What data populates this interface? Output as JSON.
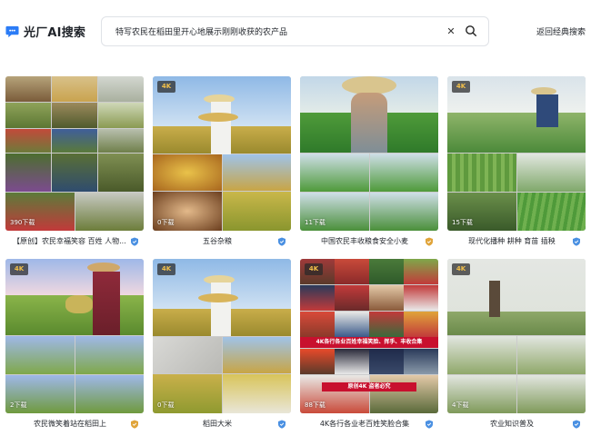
{
  "header": {
    "logo_text": "光厂AI搜索",
    "search_value": "特写农民在稻田里开心地展示刚刚收获的农产品",
    "back_label": "返回经典搜索"
  },
  "colors": {
    "accent": "#2b7cf6",
    "badge_text": "#f2c04a",
    "verify_blue": "#4a90e2",
    "verify_gold": "#e0a43a"
  },
  "cards": [
    {
      "caption": "【原创】农民幸福笑容 百姓 人物...",
      "badge": "",
      "downloads": "390下载",
      "verify": "blue"
    },
    {
      "caption": "五谷杂粮",
      "badge": "4K",
      "downloads": "0下载",
      "verify": "blue"
    },
    {
      "caption": "中国农民丰收粮食安全小麦",
      "badge": "",
      "downloads": "11下载",
      "verify": "gold"
    },
    {
      "caption": "现代化播种 耕种 育苗 插秧",
      "badge": "4K",
      "downloads": "15下载",
      "verify": "blue"
    },
    {
      "caption": "农民微笑着站在稻田上",
      "badge": "4K",
      "downloads": "2下载",
      "verify": "gold"
    },
    {
      "caption": "稻田大米",
      "badge": "4K",
      "downloads": "0下载",
      "verify": "blue"
    },
    {
      "caption": "4K各行各业老百姓笑脸合集",
      "badge": "4K",
      "downloads": "88下载",
      "verify": "blue",
      "overlay_1": "4K各行各业百姓幸福笑脸、挥手、丰收合集",
      "overlay_2": "原创4K 盗者必究"
    },
    {
      "caption": "农业知识普及",
      "badge": "4K",
      "downloads": "4下载",
      "verify": "blue"
    }
  ]
}
